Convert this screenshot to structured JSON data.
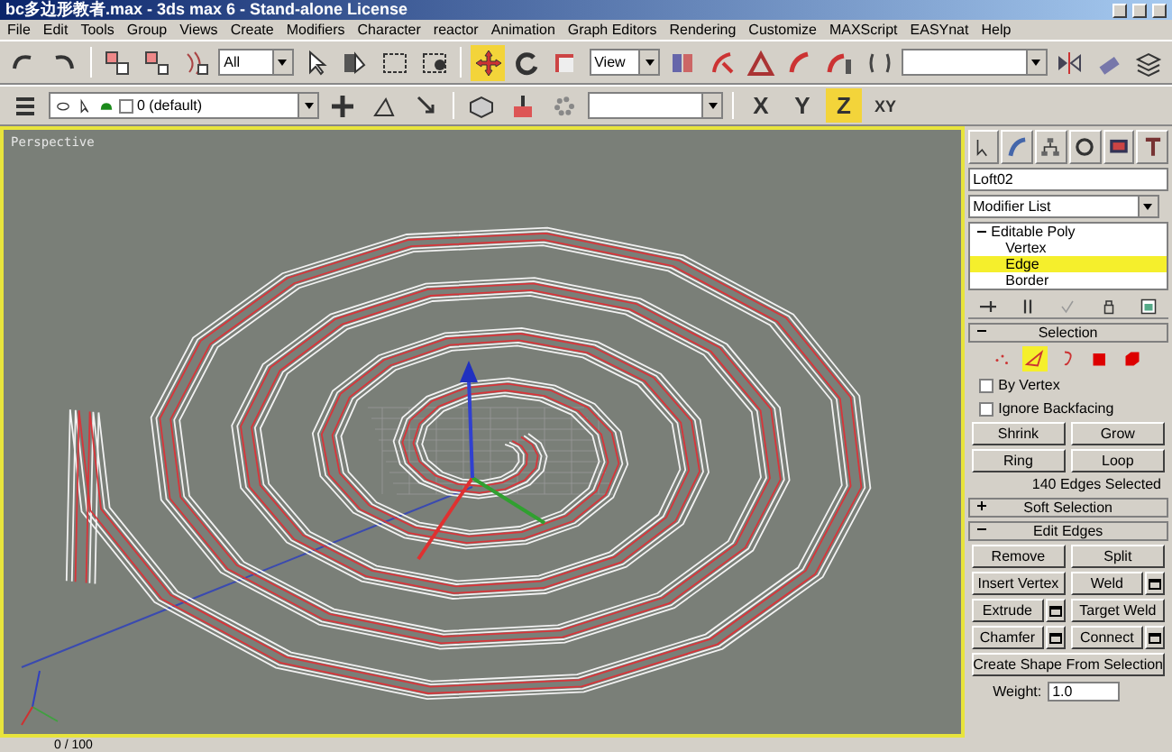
{
  "window": {
    "title": "bc多边形教者.max - 3ds max 6 - Stand-alone License"
  },
  "menu": [
    "File",
    "Edit",
    "Tools",
    "Group",
    "Views",
    "Create",
    "Modifiers",
    "Character",
    "reactor",
    "Animation",
    "Graph Editors",
    "Rendering",
    "Customize",
    "MAXScript",
    "EASYnat",
    "Help"
  ],
  "main_toolbar": {
    "selection_filter": "All",
    "reference_coordinate": "View",
    "transform_tools": [
      {
        "selected": true
      },
      {
        "selected": false
      },
      {
        "selected": false
      }
    ]
  },
  "layer_toolbar": {
    "layer": "0 (default)",
    "axis_constraints": [
      {
        "label": "X",
        "selected": false
      },
      {
        "label": "Y",
        "selected": false
      },
      {
        "label": "Z",
        "selected": true
      },
      {
        "label": "XY",
        "selected": false
      }
    ]
  },
  "viewport": {
    "label": "Perspective"
  },
  "command_panel": {
    "object_name": "Loft02",
    "modifier_list": "Modifier List",
    "stack": [
      {
        "label": "Editable Poly",
        "expanded": true,
        "selected": false,
        "children": [
          {
            "label": "Vertex",
            "selected": false
          },
          {
            "label": "Edge",
            "selected": true
          },
          {
            "label": "Border",
            "selected": false
          }
        ]
      }
    ],
    "selection": {
      "title": "Selection",
      "expanded": true,
      "levels": [
        {
          "selected": false
        },
        {
          "selected": true
        },
        {
          "selected": false
        },
        {
          "selected": false
        },
        {
          "selected": false
        }
      ],
      "checkboxes": [
        {
          "label": "By Vertex",
          "checked": false
        },
        {
          "label": "Ignore Backfacing",
          "checked": false
        }
      ],
      "buttons": [
        "Shrink",
        "Grow",
        "Ring",
        "Loop"
      ],
      "status": "140 Edges Selected"
    },
    "soft_selection": {
      "title": "Soft Selection",
      "expanded": false
    },
    "edit_edges": {
      "title": "Edit Edges",
      "expanded": true,
      "buttons": [
        {
          "label": "Remove",
          "settings": false
        },
        {
          "label": "Split",
          "settings": false
        },
        {
          "label": "Insert Vertex",
          "settings": false
        },
        {
          "label": "Weld",
          "settings": true
        },
        {
          "label": "Extrude",
          "settings": true
        },
        {
          "label": "Target Weld",
          "settings": false
        },
        {
          "label": "Chamfer",
          "settings": true
        },
        {
          "label": "Connect",
          "settings": true
        }
      ],
      "wide_button": "Create Shape From Selection",
      "weight_label": "Weight:",
      "weight_value": "1.0"
    }
  },
  "timeline": {
    "frame": "0 / 100"
  }
}
